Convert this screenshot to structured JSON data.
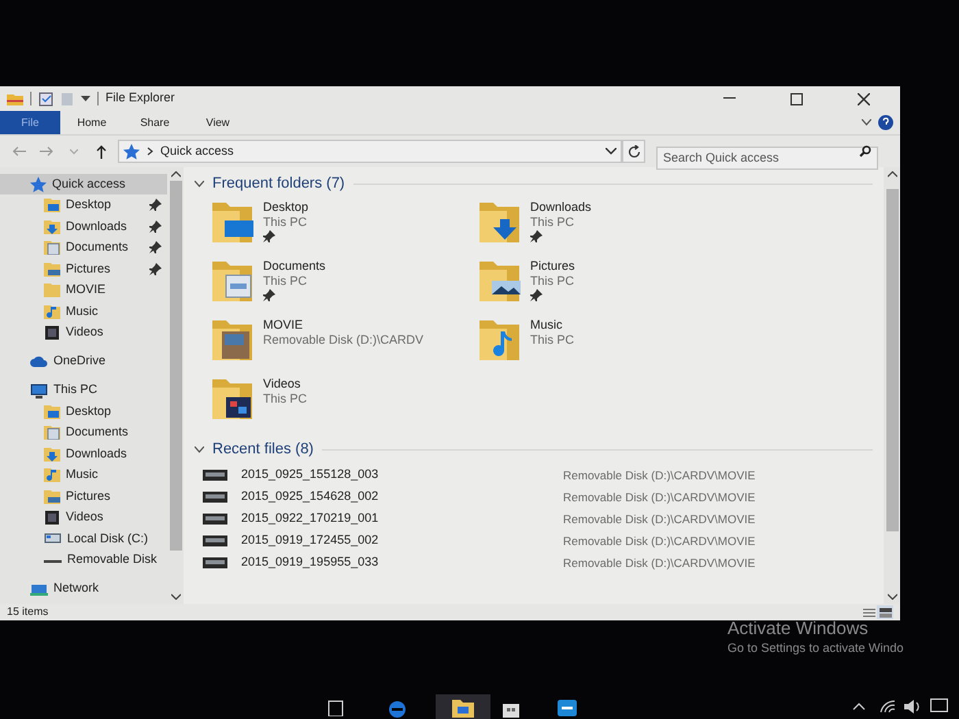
{
  "window": {
    "title": "File Explorer"
  },
  "ribbon": {
    "tabs": [
      {
        "label": "File",
        "selected": true
      },
      {
        "label": "Home",
        "selected": false
      },
      {
        "label": "Share",
        "selected": false
      },
      {
        "label": "View",
        "selected": false
      }
    ]
  },
  "address": {
    "path": "Quick access",
    "search": {
      "placeholder": "Search Quick access"
    }
  },
  "sidebar": {
    "items": [
      {
        "label": "Quick access",
        "kind": "star",
        "selected": true,
        "children": [
          {
            "label": "Desktop",
            "kind": "desktop",
            "pinned": true,
            "selected": false
          },
          {
            "label": "Downloads",
            "kind": "downloads",
            "pinned": true,
            "selected": false
          },
          {
            "label": "Documents",
            "kind": "documents",
            "pinned": true,
            "selected": false
          },
          {
            "label": "Pictures",
            "kind": "pictures",
            "pinned": true,
            "selected": false
          },
          {
            "label": "MOVIE",
            "kind": "folder",
            "pinned": false,
            "selected": false
          },
          {
            "label": "Music",
            "kind": "music",
            "pinned": false,
            "selected": false
          },
          {
            "label": "Videos",
            "kind": "videos",
            "pinned": false,
            "selected": false
          }
        ]
      },
      {
        "label": "OneDrive",
        "kind": "cloud",
        "selected": false
      },
      {
        "label": "This PC",
        "kind": "pc",
        "selected": false,
        "children": [
          {
            "label": "Desktop",
            "kind": "desktop",
            "pinned": false,
            "selected": false
          },
          {
            "label": "Documents",
            "kind": "documents",
            "pinned": false,
            "selected": false
          },
          {
            "label": "Downloads",
            "kind": "downloads",
            "pinned": false,
            "selected": false
          },
          {
            "label": "Music",
            "kind": "music",
            "pinned": false,
            "selected": false
          },
          {
            "label": "Pictures",
            "kind": "pictures",
            "pinned": false,
            "selected": false
          },
          {
            "label": "Videos",
            "kind": "videos",
            "pinned": false,
            "selected": false
          },
          {
            "label": "Local Disk (C:)",
            "kind": "disk",
            "pinned": false,
            "selected": false
          },
          {
            "label": "Removable Disk",
            "kind": "removable",
            "pinned": false,
            "selected": false
          }
        ]
      },
      {
        "label": "Network",
        "kind": "network",
        "selected": false
      }
    ]
  },
  "frequent": {
    "title": "Frequent folders (7)",
    "expanded": true,
    "folders": [
      {
        "name": "Desktop",
        "location": "This PC",
        "kind": "desktop",
        "pinned": true
      },
      {
        "name": "Downloads",
        "location": "This PC",
        "kind": "downloads",
        "pinned": true
      },
      {
        "name": "Documents",
        "location": "This PC",
        "kind": "documents",
        "pinned": true
      },
      {
        "name": "Pictures",
        "location": "This PC",
        "kind": "pictures",
        "pinned": true
      },
      {
        "name": "MOVIE",
        "location": "Removable Disk (D:)\\CARDV",
        "kind": "movie",
        "pinned": false
      },
      {
        "name": "Music",
        "location": "This PC",
        "kind": "music",
        "pinned": false
      },
      {
        "name": "Videos",
        "location": "This PC",
        "kind": "videos",
        "pinned": false
      }
    ]
  },
  "recent": {
    "title": "Recent files (8)",
    "expanded": true,
    "files": [
      {
        "name": "2015_0925_155128_003",
        "path": "Removable Disk (D:)\\CARDV\\MOVIE"
      },
      {
        "name": "2015_0925_154628_002",
        "path": "Removable Disk (D:)\\CARDV\\MOVIE"
      },
      {
        "name": "2015_0922_170219_001",
        "path": "Removable Disk (D:)\\CARDV\\MOVIE"
      },
      {
        "name": "2015_0919_172455_002",
        "path": "Removable Disk (D:)\\CARDV\\MOVIE"
      },
      {
        "name": "2015_0919_195955_033",
        "path": "Removable Disk (D:)\\CARDV\\MOVIE"
      }
    ]
  },
  "status_bar": {
    "items": "15 items"
  },
  "activation": {
    "title": "Activate Windows",
    "subtitle": "Go to Settings to activate Windo"
  }
}
